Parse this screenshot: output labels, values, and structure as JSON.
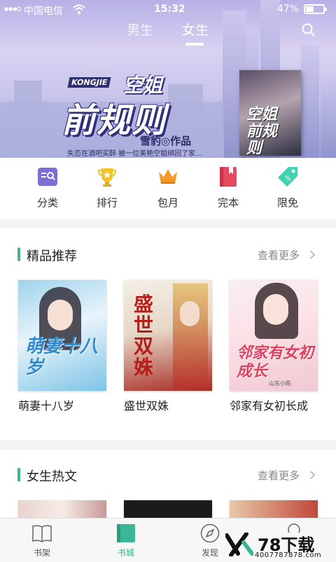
{
  "status_bar": {
    "carrier": "中国电信",
    "time": "15:32",
    "battery": "47%",
    "battery_level": 0.47
  },
  "top_tabs": [
    {
      "label": "男生",
      "active": false
    },
    {
      "label": "女生",
      "active": true
    }
  ],
  "banner": {
    "logo_sub": "KONGJIE",
    "logo_top": "空姐",
    "logo_main": "前规则",
    "author": "雪豹◎作品",
    "tagline": "失恋在酒吧买醉  被一位美艳空姐绑回了家…",
    "cover_title": "空姐前规则"
  },
  "quick_menu": [
    {
      "label": "分类",
      "icon": "category-icon",
      "color": "#7b6fd6"
    },
    {
      "label": "排行",
      "icon": "trophy-icon",
      "color": "#f2c227"
    },
    {
      "label": "包月",
      "icon": "crown-icon",
      "color": "#f59a2b"
    },
    {
      "label": "完本",
      "icon": "book-icon",
      "color": "#e64a5e"
    },
    {
      "label": "限免",
      "icon": "tag-icon",
      "color": "#3fd1b0"
    }
  ],
  "sections": [
    {
      "title": "精品推荐",
      "more": "查看更多",
      "books": [
        {
          "title": "萌妻十八岁",
          "cover_text": "萌妻十八岁"
        },
        {
          "title": "盛世双姝",
          "cover_text": "盛世双姝"
        },
        {
          "title": "邻家有女初长成",
          "cover_text": "邻家有女初成长",
          "cover_author": "山东小陈"
        }
      ]
    },
    {
      "title": "女生热文",
      "more": "查看更多",
      "books": []
    }
  ],
  "bottom_nav": [
    {
      "label": "书架",
      "icon": "bookshelf-icon",
      "active": false
    },
    {
      "label": "书城",
      "icon": "bookstore-icon",
      "active": true
    },
    {
      "label": "发现",
      "icon": "compass-icon",
      "active": false
    },
    {
      "label": "",
      "icon": "profile-icon",
      "active": false
    }
  ],
  "watermark": {
    "text": "78下载",
    "url": "400778787​8.com"
  },
  "colors": {
    "accent": "#3db597"
  }
}
